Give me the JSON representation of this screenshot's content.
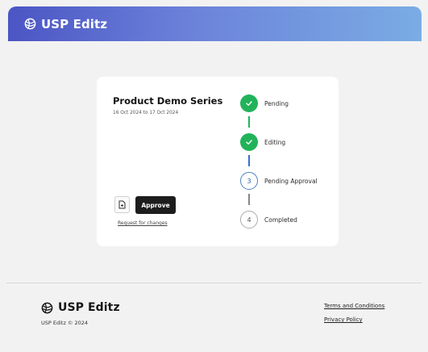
{
  "header": {
    "brand": "USP Editz",
    "logo_icon": "dotted-globe-icon"
  },
  "card": {
    "title": "Product Demo Series",
    "dates": "16 Oct 2024 to 17 Oct 2024",
    "document_icon": "document-icon",
    "approve_label": "Approve",
    "request_link": "Request for changes"
  },
  "steps": [
    {
      "label": "Pending",
      "status": "completed",
      "icon": "check-icon"
    },
    {
      "label": "Editing",
      "status": "completed",
      "icon": "check-icon"
    },
    {
      "label": "Pending Approval",
      "status": "current",
      "number": "3"
    },
    {
      "label": "Completed",
      "status": "upcoming",
      "number": "4"
    }
  ],
  "colors": {
    "completed": "#22b35a",
    "current": "#4a82c8",
    "upcoming": "#aaaaaa",
    "header_start": "#4b55c4",
    "header_end": "#7aace4"
  },
  "footer": {
    "brand": "USP Editz",
    "copyright": "USP Editz © 2024",
    "links": [
      "Terms and Conditions",
      "Privacy Policy"
    ]
  }
}
